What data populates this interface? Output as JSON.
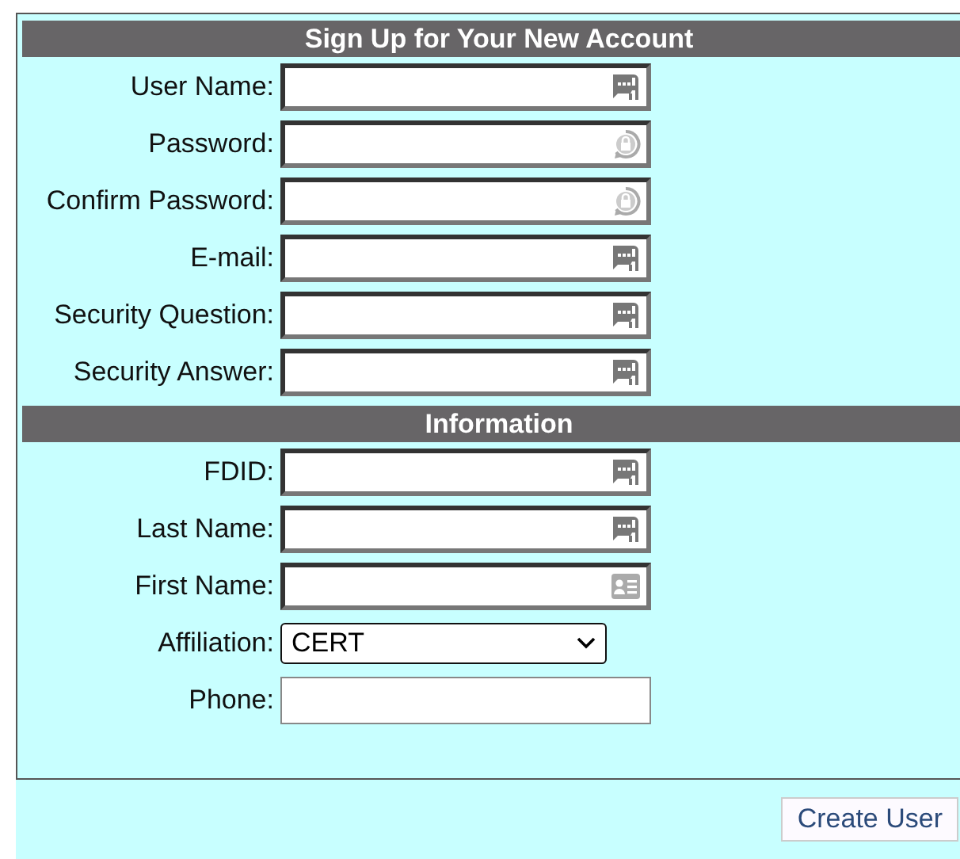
{
  "sections": [
    {
      "title": "Sign Up for Your New Account",
      "fields": [
        {
          "label": "User Name:",
          "kind": "autofill"
        },
        {
          "label": "Password:",
          "kind": "password"
        },
        {
          "label": "Confirm Password:",
          "kind": "password"
        },
        {
          "label": "E-mail:",
          "kind": "autofill"
        },
        {
          "label": "Security Question:",
          "kind": "autofill"
        },
        {
          "label": "Security Answer:",
          "kind": "autofill"
        }
      ]
    },
    {
      "title": "Information",
      "fields": [
        {
          "label": "FDID:",
          "kind": "autofill"
        },
        {
          "label": "Last Name:",
          "kind": "autofill"
        },
        {
          "label": "First Name:",
          "kind": "contact"
        },
        {
          "label": "Affiliation:",
          "kind": "select",
          "value": "CERT"
        },
        {
          "label": "Phone:",
          "kind": "plain"
        }
      ]
    }
  ],
  "button": "Create User"
}
